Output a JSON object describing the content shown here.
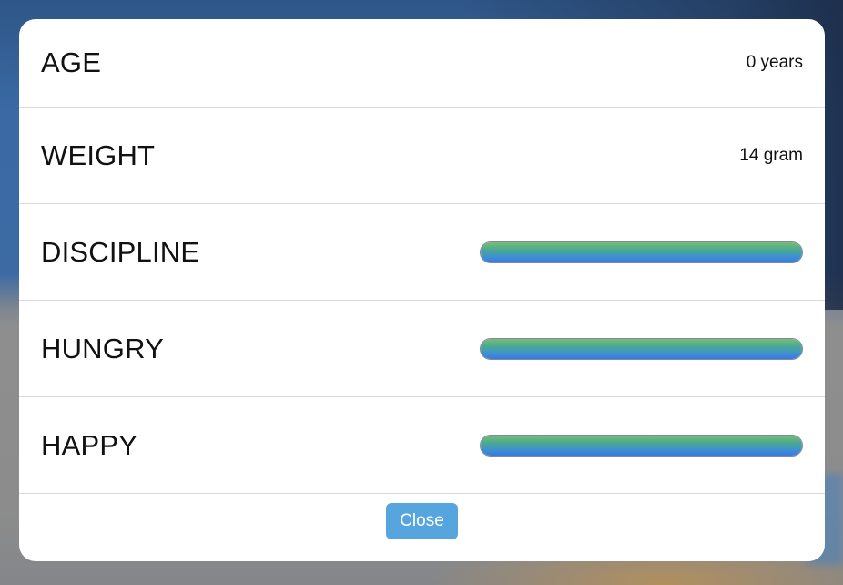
{
  "stats": {
    "age": {
      "label": "AGE",
      "value": "0 years"
    },
    "weight": {
      "label": "WEIGHT",
      "value": "14 gram"
    },
    "discipline": {
      "label": "DISCIPLINE",
      "level": 1.0
    },
    "hungry": {
      "label": "HUNGRY",
      "level": 1.0
    },
    "happy": {
      "label": "HAPPY",
      "level": 1.0
    }
  },
  "footer": {
    "close_label": "Close"
  },
  "colors": {
    "modal_background": "#ffffff",
    "close_button": "#56a5de",
    "meter_gradient_top": "#7dbb73",
    "meter_gradient_bottom": "#3c78de"
  }
}
